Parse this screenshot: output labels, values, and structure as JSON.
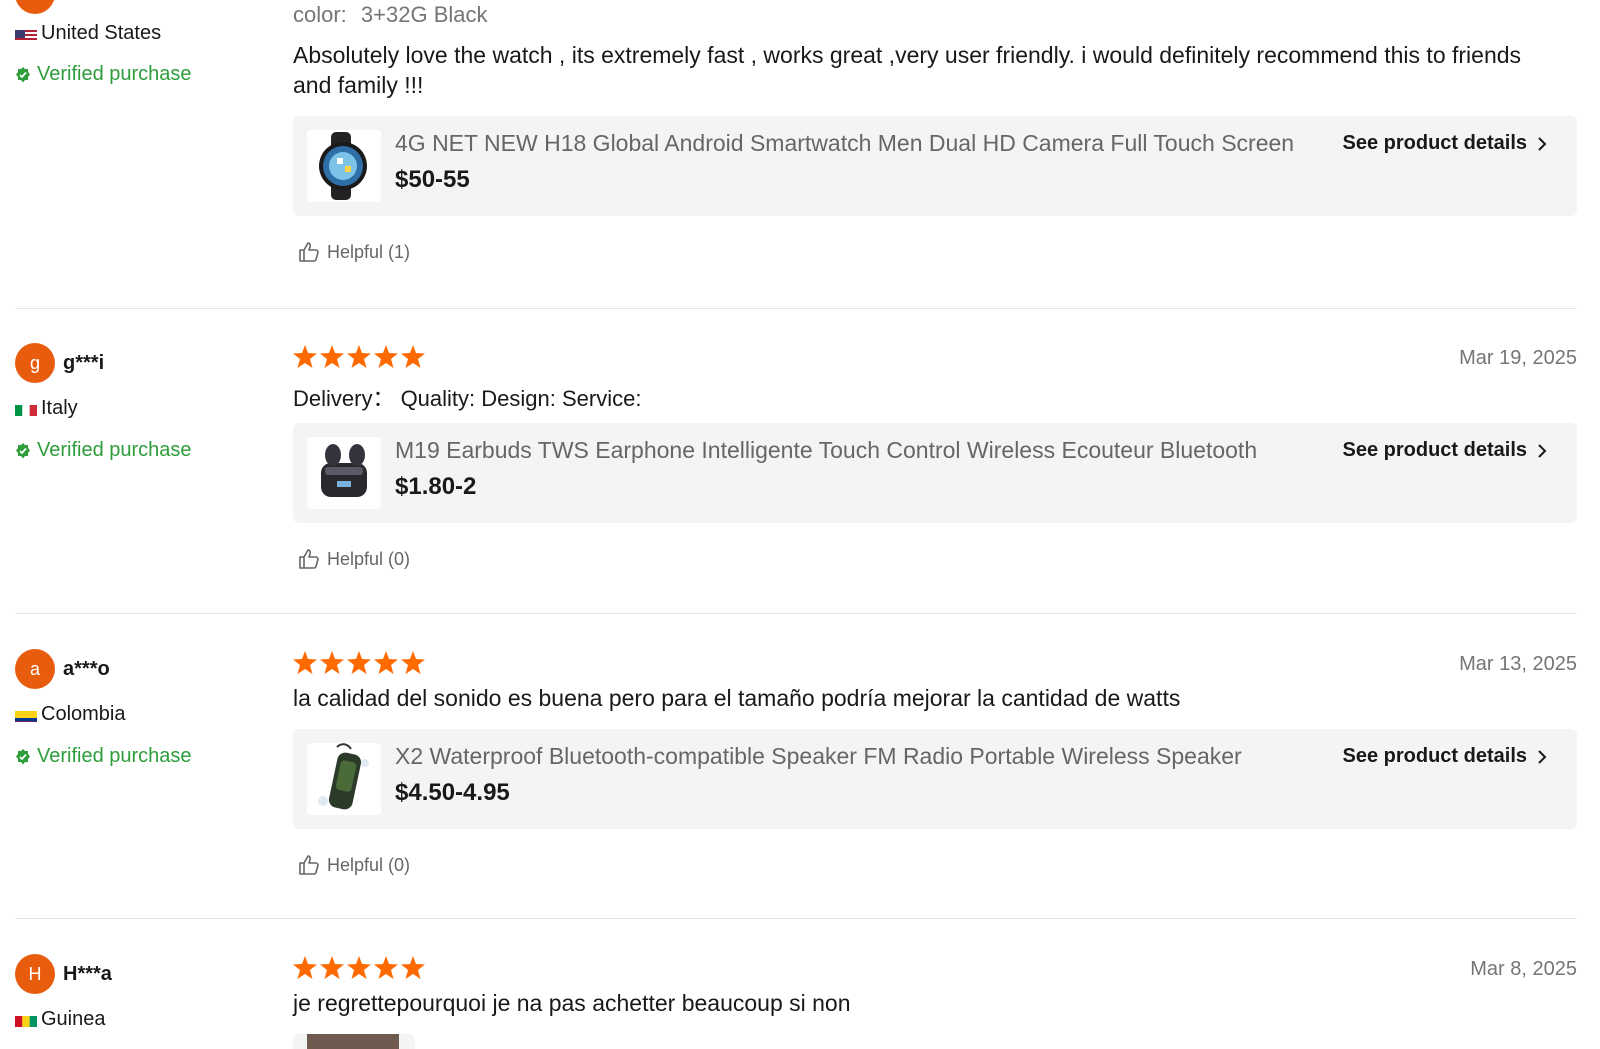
{
  "reviews": [
    {
      "avatar_letter": "",
      "username": "",
      "country": "United States",
      "verified": "Verified purchase",
      "date": "",
      "attr_key": "color:",
      "attr_value": "3+32G Black",
      "text": "Absolutely love the watch , its extremely fast , works great ,very user friendly. i would definitely recommend this to friends and family !!!",
      "product_title": "4G NET NEW H18 Global Android Smartwatch Men Dual HD Camera Full Touch Screen",
      "product_price": "$50-55",
      "product_link": "See product details",
      "helpful": "Helpful (1)"
    },
    {
      "avatar_letter": "g",
      "username": "g***i",
      "country": "Italy",
      "verified": "Verified purchase",
      "date": "Mar 19, 2025",
      "attrs": "Delivery：  Quality:  Design:  Service:",
      "text": "",
      "product_title": "M19 Earbuds TWS Earphone Intelligente Touch Control Wireless Ecouteur Bluetooth",
      "product_price": "$1.80-2",
      "product_link": "See product details",
      "helpful": "Helpful (0)"
    },
    {
      "avatar_letter": "a",
      "username": "a***o",
      "country": "Colombia",
      "verified": "Verified purchase",
      "date": "Mar 13, 2025",
      "text": "la calidad del sonido es buena pero para el tamaño podría mejorar la cantidad de watts",
      "product_title": "X2 Waterproof Bluetooth-compatible Speaker FM Radio Portable Wireless Speaker",
      "product_price": "$4.50-4.95",
      "product_link": "See product details",
      "helpful": "Helpful (0)"
    },
    {
      "avatar_letter": "H",
      "username": "H***a",
      "country": "Guinea",
      "verified": "",
      "date": "Mar 8, 2025",
      "text": "je regrettepourquoi je na pas achetter beaucoup si non"
    }
  ],
  "colors": {
    "star": "#ff6a00",
    "avatar": "#e85c0d",
    "verified": "#2e9d3a"
  },
  "ratings": [
    5,
    5,
    5
  ],
  "icons": [
    "star-icon",
    "verified-badge-icon",
    "thumbs-up-icon",
    "chevron-right-icon",
    "flag-icon"
  ]
}
